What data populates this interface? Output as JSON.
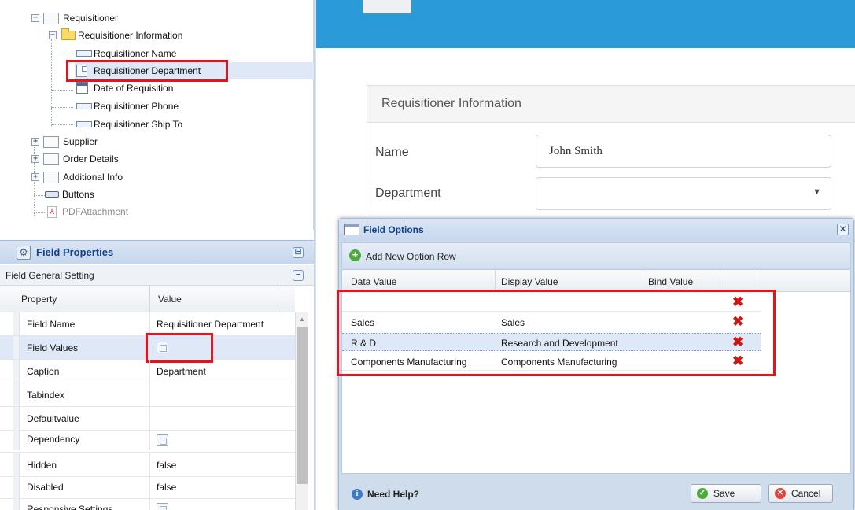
{
  "tree": {
    "nodes": [
      {
        "label": "Requisitioner",
        "kind": "page",
        "expander": "−"
      },
      {
        "label": "Requisitioner Information",
        "kind": "folder",
        "expander": "−"
      },
      {
        "label": "Requisitioner Name",
        "kind": "field"
      },
      {
        "label": "Requisitioner Department",
        "kind": "dropdown"
      },
      {
        "label": "Date of Requisition",
        "kind": "calendar"
      },
      {
        "label": "Requisitioner Phone",
        "kind": "field"
      },
      {
        "label": "Requisitioner Ship To",
        "kind": "field"
      },
      {
        "label": "Supplier",
        "kind": "page",
        "expander": "+"
      },
      {
        "label": "Order Details",
        "kind": "page",
        "expander": "+"
      },
      {
        "label": "Additional Info",
        "kind": "page",
        "expander": "+"
      },
      {
        "label": "Buttons",
        "kind": "button"
      },
      {
        "label": "PDFAttachment",
        "kind": "pdf"
      }
    ],
    "selected": "Requisitioner Department"
  },
  "field_properties": {
    "title": "Field Properties",
    "section": "Field General Setting",
    "columns": [
      "Property",
      "Value"
    ],
    "rows": [
      {
        "property": "Field Name",
        "value": "Requisitioner Department"
      },
      {
        "property": "Field Values",
        "value": "",
        "editor": "edit-icon"
      },
      {
        "property": "Caption",
        "value": "Department"
      },
      {
        "property": "Tabindex",
        "value": ""
      },
      {
        "property": "Defaultvalue",
        "value": ""
      },
      {
        "property": "Dependency",
        "value": "",
        "editor": "edit-icon"
      },
      {
        "property": "Hidden",
        "value": "false"
      },
      {
        "property": "Disabled",
        "value": "false"
      },
      {
        "property": "Responsive Settings",
        "value": "",
        "editor": "edit-icon"
      }
    ]
  },
  "preview": {
    "section_title": "Requisitioner Information",
    "name_label": "Name",
    "name_value": "John Smith",
    "department_label": "Department",
    "department_value": ""
  },
  "field_options": {
    "title": "Field Options",
    "add_row_label": "Add New Option Row",
    "columns": [
      "Data Value",
      "Display Value",
      "Bind Value"
    ],
    "rows": [
      {
        "data": "",
        "display": "",
        "bind": ""
      },
      {
        "data": "Sales",
        "display": "Sales",
        "bind": ""
      },
      {
        "data": "R & D",
        "display": "Research and Development",
        "bind": ""
      },
      {
        "data": "Components Manufacturing",
        "display": "Components Manufacturing",
        "bind": ""
      }
    ],
    "help_label": "Need Help?",
    "save_label": "Save",
    "cancel_label": "Cancel"
  },
  "colors": {
    "header_blue": "#2b9ad9",
    "panel_title": "#15428b",
    "highlight_red": "#e8121a",
    "delete_red": "#d01515",
    "selection_bg": "#dfe8f6"
  }
}
